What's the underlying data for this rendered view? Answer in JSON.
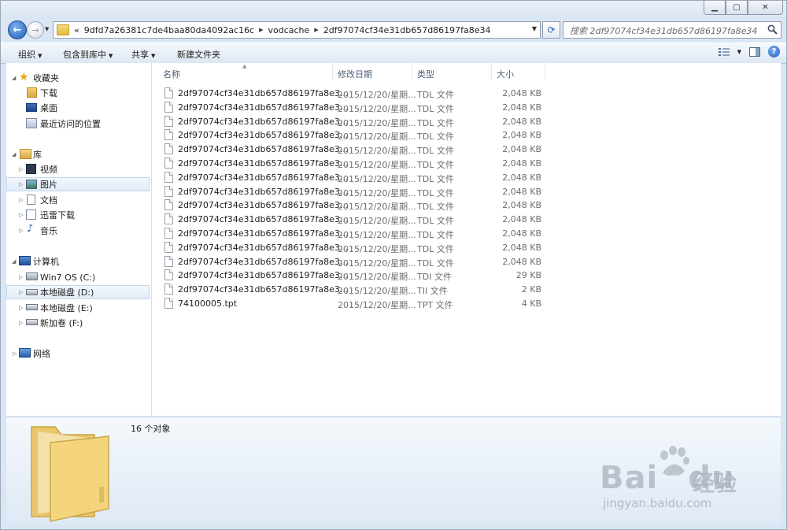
{
  "window": {
    "caption_buttons": [
      "minimize-icon",
      "maximize-icon",
      "close-icon"
    ]
  },
  "address_bar": {
    "overflow": "«",
    "crumbs": [
      "9dfd7a26381c7de4baa80da4092ac16c",
      "vodcache",
      "2df97074cf34e31db657d86197fa8e34"
    ]
  },
  "search": {
    "placeholder": "搜索 2df97074cf34e31db657d86197fa8e34"
  },
  "toolbar": {
    "organize": "组织",
    "include_in_library": "包含到库中",
    "share": "共享",
    "new_folder": "新建文件夹"
  },
  "nav": {
    "favorites": "收藏夹",
    "downloads": "下载",
    "desktop": "桌面",
    "recent": "最近访问的位置",
    "libraries": "库",
    "videos": "视频",
    "pictures": "图片",
    "documents": "文档",
    "xunlei": "迅雷下载",
    "music": "音乐",
    "computer": "计算机",
    "drive_c": "Win7 OS (C:)",
    "drive_d": "本地磁盘 (D:)",
    "drive_e": "本地磁盘 (E:)",
    "drive_f": "新加卷 (F:)",
    "network": "网络"
  },
  "columns": {
    "name": "名称",
    "date": "修改日期",
    "type": "类型",
    "size": "大小"
  },
  "files": [
    {
      "name": "2df97074cf34e31db657d86197fa8e3...",
      "date": "2015/12/20/星期...",
      "type": "TDL 文件",
      "size": "2,048 KB"
    },
    {
      "name": "2df97074cf34e31db657d86197fa8e3...",
      "date": "2015/12/20/星期...",
      "type": "TDL 文件",
      "size": "2,048 KB"
    },
    {
      "name": "2df97074cf34e31db657d86197fa8e3...",
      "date": "2015/12/20/星期...",
      "type": "TDL 文件",
      "size": "2,048 KB"
    },
    {
      "name": "2df97074cf34e31db657d86197fa8e3...",
      "date": "2015/12/20/星期...",
      "type": "TDL 文件",
      "size": "2,048 KB"
    },
    {
      "name": "2df97074cf34e31db657d86197fa8e3...",
      "date": "2015/12/20/星期...",
      "type": "TDL 文件",
      "size": "2,048 KB"
    },
    {
      "name": "2df97074cf34e31db657d86197fa8e3...",
      "date": "2015/12/20/星期...",
      "type": "TDL 文件",
      "size": "2,048 KB"
    },
    {
      "name": "2df97074cf34e31db657d86197fa8e3...",
      "date": "2015/12/20/星期...",
      "type": "TDL 文件",
      "size": "2,048 KB"
    },
    {
      "name": "2df97074cf34e31db657d86197fa8e3...",
      "date": "2015/12/20/星期...",
      "type": "TDL 文件",
      "size": "2,048 KB"
    },
    {
      "name": "2df97074cf34e31db657d86197fa8e3...",
      "date": "2015/12/20/星期...",
      "type": "TDL 文件",
      "size": "2,048 KB"
    },
    {
      "name": "2df97074cf34e31db657d86197fa8e3...",
      "date": "2015/12/20/星期...",
      "type": "TDL 文件",
      "size": "2,048 KB"
    },
    {
      "name": "2df97074cf34e31db657d86197fa8e3...",
      "date": "2015/12/20/星期...",
      "type": "TDL 文件",
      "size": "2,048 KB"
    },
    {
      "name": "2df97074cf34e31db657d86197fa8e3...",
      "date": "2015/12/20/星期...",
      "type": "TDL 文件",
      "size": "2,048 KB"
    },
    {
      "name": "2df97074cf34e31db657d86197fa8e3...",
      "date": "2015/12/20/星期...",
      "type": "TDL 文件",
      "size": "2,048 KB"
    },
    {
      "name": "2df97074cf34e31db657d86197fa8e3...",
      "date": "2015/12/20/星期...",
      "type": "TDI 文件",
      "size": "29 KB"
    },
    {
      "name": "2df97074cf34e31db657d86197fa8e3...",
      "date": "2015/12/20/星期...",
      "type": "TII 文件",
      "size": "2 KB"
    },
    {
      "name": "74100005.tpt",
      "date": "2015/12/20/星期...",
      "type": "TPT 文件",
      "size": "4 KB"
    }
  ],
  "details": {
    "count": "16 个对象"
  },
  "watermark": {
    "brand": "Bai",
    "brand2": "du",
    "jingyan": "经验",
    "url": "jingyan.baidu.com"
  }
}
